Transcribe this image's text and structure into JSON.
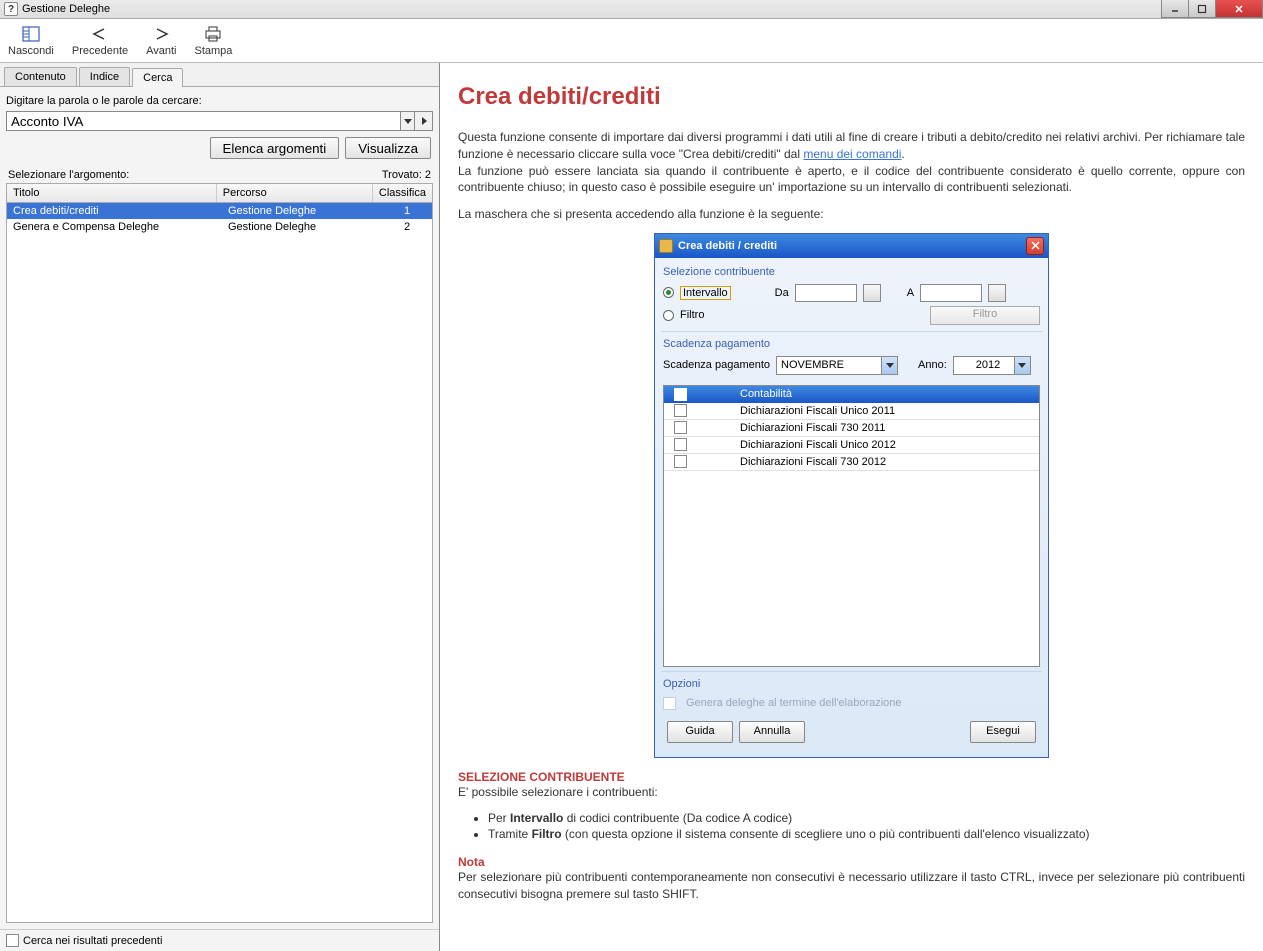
{
  "window": {
    "title": "Gestione Deleghe"
  },
  "toolbar": {
    "hide": "Nascondi",
    "prev": "Precedente",
    "next": "Avanti",
    "print": "Stampa"
  },
  "sidebar": {
    "tabs": {
      "content": "Contenuto",
      "index": "Indice",
      "search": "Cerca"
    },
    "prompt": "Digitare la parola o le parole da cercare:",
    "search_value": "Acconto IVA",
    "list_btn": "Elenca argomenti",
    "show_btn": "Visualizza",
    "select_topic": "Selezionare l'argomento:",
    "found": "Trovato: 2",
    "cols": {
      "title": "Titolo",
      "path": "Percorso",
      "rank": "Classifica"
    },
    "rows": [
      {
        "t": "Crea debiti/crediti",
        "p": "Gestione Deleghe",
        "r": "1"
      },
      {
        "t": "Genera e Compensa Deleghe",
        "p": "Gestione Deleghe",
        "r": "2"
      }
    ],
    "prev_results": "Cerca nei risultati precedenti"
  },
  "content": {
    "h1": "Crea debiti/crediti",
    "p1a": "Questa funzione consente di importare dai diversi programmi i dati utili al fine di creare i tributi a debito/credito nei relativi archivi. Per richiamare tale funzione è necessario cliccare sulla voce \"Crea debiti/crediti\" dal ",
    "p1link": "menu dei comandi",
    "p1b": ".",
    "p2": "La funzione può essere lanciata sia quando il contribuente è aperto, e il codice del contribuente considerato è quello corrente, oppure con contribuente chiuso; in questo caso è possibile eseguire un' importazione su un intervallo di contribuenti selezionati.",
    "p3": "La maschera che si presenta accedendo alla funzione è la seguente:",
    "sec_title": "SELEZIONE CONTRIBUENTE",
    "sec_p": "E' possibile selezionare i contribuenti:",
    "b1a": "Per ",
    "b1b": "Intervallo",
    "b1c": " di codici contribuente (Da codice A codice)",
    "b2a": "Tramite ",
    "b2b": "Filtro",
    "b2c": " (con questa opzione il sistema consente di scegliere uno o più contribuenti dall'elenco visualizzato)",
    "nota": "Nota",
    "notap": "Per selezionare più contribuenti contemporaneamente non consecutivi è necessario utilizzare il tasto CTRL, invece per selezionare più contribuenti consecutivi bisogna premere sul tasto SHIFT."
  },
  "dialog": {
    "title": "Crea debiti / crediti",
    "sec1": "Selezione contribuente",
    "intervallo": "Intervallo",
    "da": "Da",
    "a": "A",
    "filtro": "Filtro",
    "filtro_btn": "Filtro",
    "sec2": "Scadenza pagamento",
    "scad_label": "Scadenza pagamento",
    "scad_val": "NOVEMBRE",
    "anno_label": "Anno:",
    "anno_val": "2012",
    "list_head": "Contabilità",
    "list": [
      "Dichiarazioni Fiscali Unico 2011",
      "Dichiarazioni Fiscali 730 2011",
      "Dichiarazioni Fiscali Unico 2012",
      "Dichiarazioni Fiscali 730 2012"
    ],
    "sec3": "Opzioni",
    "opt": "Genera deleghe al termine dell'elaborazione",
    "guida": "Guida",
    "annulla": "Annulla",
    "esegui": "Esegui"
  }
}
